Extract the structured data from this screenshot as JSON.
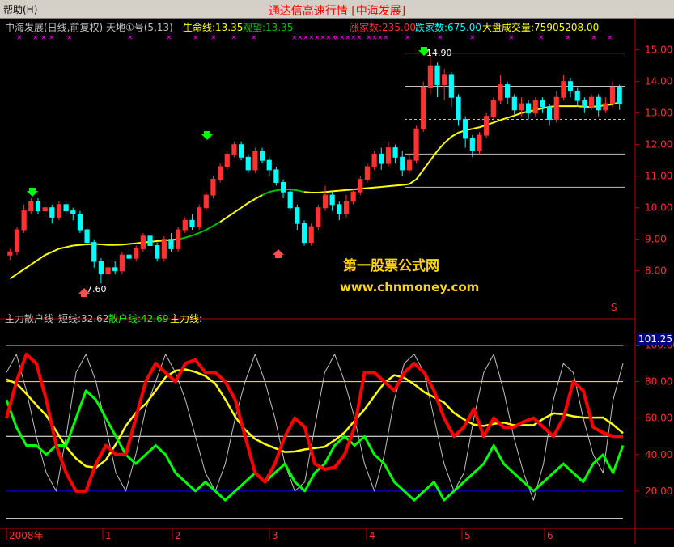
{
  "menubar": {
    "help": "帮助(H)"
  },
  "window_title": "通达信高速行情 [中海发展]",
  "upper_panel": {
    "stock_label": "中海发展(日线,前复权) 天地①号(5,13)",
    "life_line": "生命线:13.35",
    "watch": "观望:13.35",
    "up_count": "涨家数:235.00",
    "down_count": "跌家数:675.00",
    "market_volume": "大盘成交量:75905208.00",
    "yticks": [
      "15.00",
      "14.00",
      "13.00",
      "12.00",
      "11.00",
      "10.00",
      "9.00",
      "8.00"
    ],
    "high_label": "14.90",
    "low_label": "7.60",
    "watermark_name": "第一股票公式网",
    "watermark_url": "www.chnmoney.com",
    "s_marker": "S"
  },
  "lower_panel": {
    "title": "主力散户线",
    "short_line": "短线:32.62",
    "retail_line": "散户线:42.69",
    "main_line": "主力线:",
    "current_value": "101.25",
    "yticks": [
      "100.00",
      "80.00",
      "60.00",
      "40.00",
      "20.00"
    ]
  },
  "x_axis": {
    "labels": [
      "2008年",
      "1",
      "2",
      "3",
      "4",
      "5",
      "6"
    ]
  },
  "colors": {
    "up": "#ff3232",
    "down": "#00ffff",
    "life": "#ffff00",
    "mid": "#00c000",
    "magenta": "#ff00ff",
    "retail": "#ff0000",
    "main": "#00ff00",
    "short": "#c0c0c0"
  },
  "chart_data": {
    "type": "candlestick",
    "upper": {
      "ylim": [
        7.3,
        15.3
      ],
      "candles": [
        [
          8.5,
          8.6,
          8.35,
          8.7
        ],
        [
          8.6,
          9.3,
          8.5,
          9.4
        ],
        [
          9.3,
          9.9,
          9.2,
          10.1
        ],
        [
          9.9,
          10.2,
          9.8,
          10.3
        ],
        [
          10.2,
          9.9,
          9.8,
          10.3
        ],
        [
          9.9,
          10.0,
          9.7,
          10.2
        ],
        [
          10.0,
          9.7,
          9.5,
          10.1
        ],
        [
          9.7,
          10.1,
          9.6,
          10.2
        ],
        [
          10.1,
          9.9,
          9.8,
          10.2
        ],
        [
          9.9,
          9.8,
          9.6,
          10.0
        ],
        [
          9.8,
          9.3,
          9.2,
          9.9
        ],
        [
          9.3,
          8.9,
          8.8,
          9.4
        ],
        [
          8.9,
          8.3,
          8.1,
          9.0
        ],
        [
          8.3,
          7.9,
          7.6,
          8.4
        ],
        [
          7.9,
          8.1,
          7.7,
          8.3
        ],
        [
          8.1,
          8.0,
          7.9,
          8.3
        ],
        [
          8.0,
          8.5,
          7.9,
          8.6
        ],
        [
          8.5,
          8.4,
          8.2,
          8.7
        ],
        [
          8.4,
          8.7,
          8.3,
          8.8
        ],
        [
          8.7,
          9.1,
          8.6,
          9.2
        ],
        [
          9.1,
          8.8,
          8.7,
          9.2
        ],
        [
          8.8,
          8.4,
          8.3,
          8.9
        ],
        [
          8.4,
          9.0,
          8.3,
          9.1
        ],
        [
          9.0,
          8.7,
          8.6,
          9.2
        ],
        [
          8.7,
          9.3,
          8.6,
          9.4
        ],
        [
          9.3,
          9.6,
          9.2,
          9.7
        ],
        [
          9.6,
          9.4,
          9.3,
          9.8
        ],
        [
          9.4,
          10.0,
          9.3,
          10.1
        ],
        [
          10.0,
          10.4,
          9.9,
          10.5
        ],
        [
          10.4,
          10.9,
          10.3,
          11.0
        ],
        [
          10.9,
          11.3,
          10.8,
          11.4
        ],
        [
          11.3,
          11.7,
          11.2,
          11.8
        ],
        [
          11.7,
          12.0,
          11.6,
          12.1
        ],
        [
          12.0,
          11.6,
          11.5,
          12.1
        ],
        [
          11.6,
          11.2,
          11.1,
          11.7
        ],
        [
          11.2,
          11.8,
          11.1,
          11.9
        ],
        [
          11.8,
          11.5,
          11.4,
          11.9
        ],
        [
          11.5,
          11.2,
          11.0,
          11.6
        ],
        [
          11.2,
          10.8,
          10.7,
          11.3
        ],
        [
          10.8,
          10.5,
          10.3,
          10.9
        ],
        [
          10.5,
          10.0,
          9.9,
          10.6
        ],
        [
          10.0,
          9.5,
          9.3,
          10.1
        ],
        [
          9.5,
          8.9,
          8.8,
          9.6
        ],
        [
          8.9,
          9.4,
          8.8,
          9.5
        ],
        [
          9.4,
          10.0,
          9.3,
          10.1
        ],
        [
          10.0,
          10.4,
          9.9,
          10.7
        ],
        [
          10.4,
          10.1,
          9.9,
          10.5
        ],
        [
          10.1,
          9.8,
          9.6,
          10.2
        ],
        [
          9.8,
          10.2,
          9.7,
          10.4
        ],
        [
          10.2,
          10.5,
          10.1,
          10.6
        ],
        [
          10.5,
          10.9,
          10.4,
          11.0
        ],
        [
          10.9,
          11.3,
          10.8,
          11.4
        ],
        [
          11.3,
          11.7,
          11.2,
          11.8
        ],
        [
          11.7,
          11.4,
          11.2,
          11.9
        ],
        [
          11.4,
          11.9,
          11.3,
          12.1
        ],
        [
          11.9,
          11.6,
          11.4,
          12.0
        ],
        [
          11.6,
          11.2,
          11.0,
          11.8
        ],
        [
          11.2,
          11.5,
          11.1,
          11.7
        ],
        [
          11.5,
          12.5,
          11.4,
          12.6
        ],
        [
          12.5,
          13.8,
          12.4,
          14.0
        ],
        [
          13.8,
          14.5,
          13.6,
          14.9
        ],
        [
          14.5,
          13.9,
          13.5,
          14.6
        ],
        [
          13.9,
          14.2,
          13.4,
          14.4
        ],
        [
          14.2,
          13.5,
          13.2,
          14.3
        ],
        [
          13.5,
          12.8,
          12.6,
          13.6
        ],
        [
          12.8,
          12.2,
          11.9,
          12.9
        ],
        [
          12.2,
          11.8,
          11.6,
          12.3
        ],
        [
          11.8,
          12.3,
          11.7,
          12.4
        ],
        [
          12.3,
          12.9,
          12.2,
          13.0
        ],
        [
          12.9,
          13.4,
          12.8,
          13.5
        ],
        [
          13.4,
          13.9,
          13.3,
          14.2
        ],
        [
          13.9,
          13.5,
          13.3,
          14.0
        ],
        [
          13.5,
          13.1,
          12.9,
          13.6
        ],
        [
          13.1,
          13.3,
          12.9,
          13.5
        ],
        [
          13.3,
          13.0,
          12.8,
          13.4
        ],
        [
          13.0,
          13.4,
          12.9,
          13.5
        ],
        [
          13.4,
          13.2,
          13.0,
          13.5
        ],
        [
          13.2,
          12.8,
          12.6,
          13.3
        ],
        [
          12.8,
          13.5,
          12.7,
          13.7
        ],
        [
          13.5,
          14.0,
          13.4,
          14.2
        ],
        [
          14.0,
          13.7,
          13.5,
          14.1
        ],
        [
          13.7,
          13.4,
          13.2,
          13.8
        ],
        [
          13.4,
          13.2,
          13.0,
          13.5
        ],
        [
          13.2,
          13.5,
          13.1,
          13.6
        ],
        [
          13.5,
          13.1,
          12.9,
          13.6
        ],
        [
          13.1,
          13.3,
          13.0,
          13.5
        ],
        [
          13.3,
          13.8,
          13.2,
          14.0
        ],
        [
          13.8,
          13.3,
          13.1,
          13.9
        ]
      ],
      "life_line": [
        7.75,
        7.9,
        8.05,
        8.2,
        8.35,
        8.5,
        8.6,
        8.7,
        8.75,
        8.8,
        8.82,
        8.84,
        8.85,
        8.84,
        8.82,
        8.82,
        8.83,
        8.85,
        8.87,
        8.9,
        8.92,
        8.94,
        8.96,
        8.98,
        9.0,
        9.05,
        9.12,
        9.2,
        9.3,
        9.42,
        9.55,
        9.7,
        9.85,
        10.0,
        10.15,
        10.28,
        10.4,
        10.5,
        10.55,
        10.58,
        10.58,
        10.55,
        10.5,
        10.48,
        10.48,
        10.5,
        10.52,
        10.54,
        10.56,
        10.58,
        10.6,
        10.62,
        10.64,
        10.66,
        10.68,
        10.7,
        10.72,
        10.75,
        10.9,
        11.2,
        11.5,
        11.8,
        12.05,
        12.25,
        12.38,
        12.45,
        12.5,
        12.55,
        12.62,
        12.7,
        12.78,
        12.85,
        12.92,
        13.0,
        13.05,
        13.1,
        13.15,
        13.2,
        13.22,
        13.22,
        13.22,
        13.22,
        13.2,
        13.2,
        13.22,
        13.25,
        13.28,
        13.35
      ],
      "horizontal_levels": [
        14.9,
        13.85,
        12.8,
        11.7,
        10.65
      ],
      "high": 14.9,
      "low": 7.6
    },
    "lower": {
      "ylim": [
        0,
        110
      ],
      "reference_lines": [
        100,
        80,
        50,
        20,
        5
      ],
      "retail": [
        60,
        80,
        95,
        90,
        70,
        45,
        30,
        20,
        20,
        35,
        45,
        40,
        40,
        60,
        80,
        90,
        85,
        80,
        90,
        92,
        85,
        85,
        80,
        70,
        50,
        30,
        25,
        35,
        50,
        60,
        55,
        35,
        32,
        33,
        40,
        55,
        85,
        85,
        80,
        75,
        85,
        90,
        85,
        75,
        60,
        50,
        55,
        65,
        50,
        60,
        55,
        55,
        58,
        60,
        55,
        50,
        60,
        80,
        75,
        55,
        52,
        50,
        50
      ],
      "main": [
        70,
        55,
        45,
        45,
        40,
        45,
        45,
        60,
        75,
        70,
        60,
        50,
        40,
        35,
        40,
        45,
        40,
        30,
        25,
        20,
        25,
        20,
        15,
        20,
        25,
        30,
        25,
        30,
        35,
        25,
        20,
        30,
        35,
        45,
        50,
        45,
        50,
        40,
        35,
        25,
        20,
        15,
        20,
        25,
        15,
        20,
        25,
        30,
        35,
        45,
        35,
        30,
        25,
        20,
        25,
        30,
        35,
        30,
        25,
        35,
        40,
        30,
        45
      ],
      "short": [
        85,
        95,
        75,
        50,
        30,
        20,
        50,
        85,
        95,
        80,
        55,
        30,
        20,
        40,
        65,
        80,
        95,
        85,
        70,
        50,
        30,
        20,
        35,
        60,
        80,
        95,
        80,
        60,
        35,
        20,
        25,
        55,
        85,
        95,
        80,
        60,
        35,
        20,
        40,
        70,
        90,
        95,
        85,
        60,
        35,
        20,
        30,
        60,
        85,
        95,
        75,
        50,
        30,
        15,
        35,
        70,
        90,
        85,
        60,
        40,
        30,
        70,
        90
      ],
      "main_ref": [
        100,
        80,
        50,
        20
      ],
      "current": 101.25
    }
  }
}
